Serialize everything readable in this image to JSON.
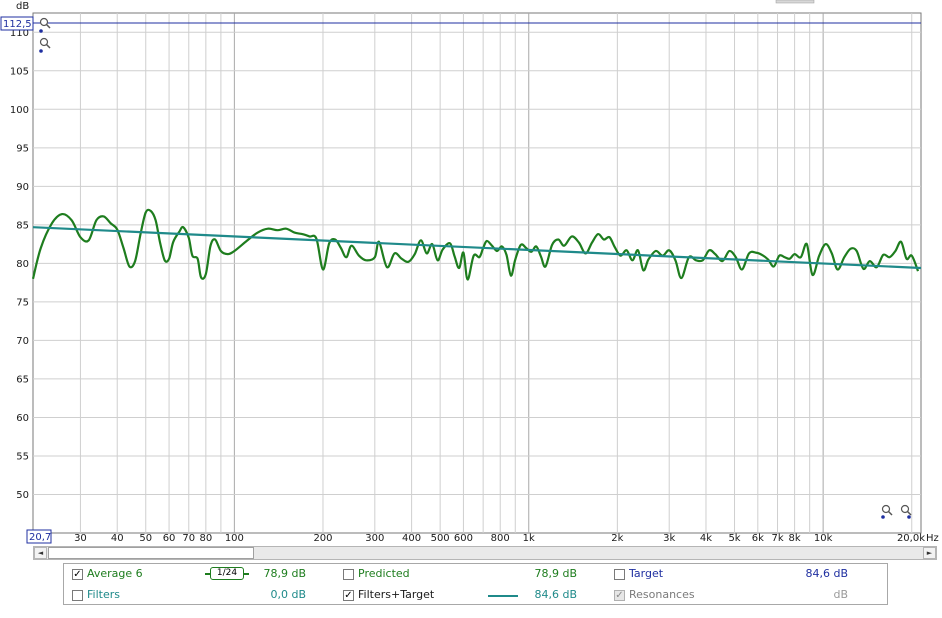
{
  "axis": {
    "y_unit": "dB",
    "x_unit": "Hz",
    "y_top_value": "112,5",
    "x_left_value": "20,7",
    "y_ticks": [
      "110",
      "105",
      "100",
      "95",
      "90",
      "85",
      "80",
      "75",
      "70",
      "65",
      "60",
      "55",
      "50"
    ],
    "x_tick_labels": [
      {
        "label": "30",
        "freq": 30
      },
      {
        "label": "40",
        "freq": 40
      },
      {
        "label": "50",
        "freq": 50
      },
      {
        "label": "60",
        "freq": 60
      },
      {
        "label": "70",
        "freq": 70
      },
      {
        "label": "80",
        "freq": 80
      },
      {
        "label": "100",
        "freq": 100
      },
      {
        "label": "200",
        "freq": 200
      },
      {
        "label": "300",
        "freq": 300
      },
      {
        "label": "400",
        "freq": 400
      },
      {
        "label": "500",
        "freq": 500
      },
      {
        "label": "600",
        "freq": 600
      },
      {
        "label": "800",
        "freq": 800
      },
      {
        "label": "1k",
        "freq": 1000
      },
      {
        "label": "2k",
        "freq": 2000
      },
      {
        "label": "3k",
        "freq": 3000
      },
      {
        "label": "4k",
        "freq": 4000
      },
      {
        "label": "5k",
        "freq": 5000
      },
      {
        "label": "6k",
        "freq": 6000
      },
      {
        "label": "7k",
        "freq": 7000
      },
      {
        "label": "8k",
        "freq": 8000
      },
      {
        "label": "10k",
        "freq": 10000
      },
      {
        "label": "20,0k",
        "freq": 20000
      }
    ]
  },
  "chart_data": {
    "type": "line",
    "x_scale": "log",
    "xlim": [
      20.7,
      21500
    ],
    "ylim": [
      45,
      112.5
    ],
    "grid": true,
    "series": [
      {
        "name": "Average 6",
        "color": "#1e7d1e",
        "points": [
          [
            20.7,
            78
          ],
          [
            22,
            82
          ],
          [
            24,
            85.2
          ],
          [
            26,
            86.4
          ],
          [
            28,
            85.6
          ],
          [
            30,
            83.4
          ],
          [
            32,
            83
          ],
          [
            34,
            85.6
          ],
          [
            36,
            86.1
          ],
          [
            38,
            85.2
          ],
          [
            40,
            84.4
          ],
          [
            42,
            82
          ],
          [
            44,
            79.6
          ],
          [
            46,
            80.3
          ],
          [
            48,
            83.8
          ],
          [
            50,
            86.6
          ],
          [
            52,
            86.8
          ],
          [
            54,
            85.6
          ],
          [
            56,
            82.6
          ],
          [
            58,
            80.4
          ],
          [
            60,
            80.6
          ],
          [
            62,
            82.8
          ],
          [
            65,
            84.1
          ],
          [
            67,
            84.7
          ],
          [
            70,
            83.3
          ],
          [
            72,
            81
          ],
          [
            75,
            80.6
          ],
          [
            77,
            78.2
          ],
          [
            80,
            78.6
          ],
          [
            83,
            82.3
          ],
          [
            86,
            83.1
          ],
          [
            90,
            81.6
          ],
          [
            95,
            81.2
          ],
          [
            100,
            81.6
          ],
          [
            110,
            82.9
          ],
          [
            120,
            84
          ],
          [
            130,
            84.5
          ],
          [
            140,
            84.3
          ],
          [
            150,
            84.5
          ],
          [
            160,
            84
          ],
          [
            170,
            83.8
          ],
          [
            180,
            83.5
          ],
          [
            190,
            83.2
          ],
          [
            200,
            79.2
          ],
          [
            210,
            82.6
          ],
          [
            220,
            83.1
          ],
          [
            230,
            82
          ],
          [
            240,
            80.8
          ],
          [
            250,
            82.3
          ],
          [
            265,
            81
          ],
          [
            280,
            80.4
          ],
          [
            300,
            80.8
          ],
          [
            310,
            82.8
          ],
          [
            330,
            79.5
          ],
          [
            350,
            81.3
          ],
          [
            370,
            80.6
          ],
          [
            390,
            80.2
          ],
          [
            410,
            81.2
          ],
          [
            430,
            83
          ],
          [
            450,
            81.3
          ],
          [
            470,
            82.5
          ],
          [
            490,
            80.4
          ],
          [
            510,
            81.8
          ],
          [
            540,
            82.6
          ],
          [
            560,
            80.9
          ],
          [
            580,
            79.4
          ],
          [
            600,
            81.4
          ],
          [
            620,
            77.9
          ],
          [
            650,
            81
          ],
          [
            680,
            80.8
          ],
          [
            700,
            82
          ],
          [
            720,
            82.9
          ],
          [
            750,
            82.3
          ],
          [
            780,
            81.6
          ],
          [
            810,
            82.2
          ],
          [
            840,
            81.1
          ],
          [
            870,
            78.4
          ],
          [
            900,
            80.5
          ],
          [
            940,
            82.4
          ],
          [
            980,
            82
          ],
          [
            1020,
            81.5
          ],
          [
            1060,
            82.2
          ],
          [
            1100,
            80.9
          ],
          [
            1140,
            79.6
          ],
          [
            1200,
            82.4
          ],
          [
            1260,
            83.1
          ],
          [
            1320,
            82.3
          ],
          [
            1400,
            83.5
          ],
          [
            1480,
            82.7
          ],
          [
            1560,
            81.3
          ],
          [
            1640,
            82.7
          ],
          [
            1720,
            83.8
          ],
          [
            1800,
            83.1
          ],
          [
            1880,
            83.4
          ],
          [
            1960,
            82.1
          ],
          [
            2050,
            81
          ],
          [
            2150,
            81.7
          ],
          [
            2250,
            80.4
          ],
          [
            2350,
            81.7
          ],
          [
            2450,
            79.1
          ],
          [
            2550,
            80.5
          ],
          [
            2700,
            81.6
          ],
          [
            2850,
            81
          ],
          [
            3000,
            81.7
          ],
          [
            3150,
            80.4
          ],
          [
            3300,
            78.1
          ],
          [
            3500,
            80.8
          ],
          [
            3700,
            80.4
          ],
          [
            3900,
            80.4
          ],
          [
            4100,
            81.7
          ],
          [
            4300,
            81.2
          ],
          [
            4550,
            80.3
          ],
          [
            4800,
            81.6
          ],
          [
            5050,
            80.8
          ],
          [
            5300,
            79.2
          ],
          [
            5600,
            81.3
          ],
          [
            5900,
            81.4
          ],
          [
            6200,
            81.1
          ],
          [
            6500,
            80.5
          ],
          [
            6800,
            79.6
          ],
          [
            7100,
            81
          ],
          [
            7400,
            80.8
          ],
          [
            7700,
            80.6
          ],
          [
            8000,
            81.2
          ],
          [
            8400,
            80.8
          ],
          [
            8800,
            82.5
          ],
          [
            9200,
            78.5
          ],
          [
            9700,
            81
          ],
          [
            10200,
            82.5
          ],
          [
            10700,
            81.3
          ],
          [
            11200,
            79.2
          ],
          [
            11800,
            80.8
          ],
          [
            12400,
            81.9
          ],
          [
            13000,
            81.6
          ],
          [
            13700,
            79.3
          ],
          [
            14400,
            80.3
          ],
          [
            15200,
            79.5
          ],
          [
            16000,
            81.1
          ],
          [
            16800,
            80.8
          ],
          [
            17600,
            81.6
          ],
          [
            18400,
            82.8
          ],
          [
            19200,
            80.6
          ],
          [
            20000,
            81
          ],
          [
            21000,
            79
          ]
        ]
      },
      {
        "name": "Target",
        "color": "#1f8a8a",
        "points": [
          [
            20.7,
            84.7
          ],
          [
            21500,
            79.4
          ]
        ]
      }
    ]
  },
  "legend": {
    "average": {
      "label": "Average 6",
      "checked": true,
      "smoothing": "1/24",
      "value": "78,9 dB",
      "color": "#1e7d1e"
    },
    "predicted": {
      "label": "Predicted",
      "checked": false,
      "value": "78,9 dB",
      "color": "#1e7d1e"
    },
    "target": {
      "label": "Target",
      "checked": false,
      "value": "84,6 dB",
      "color": "#1f2fa0"
    },
    "filters": {
      "label": "Filters",
      "checked": false,
      "value": "0,0 dB",
      "color": "#1f8a8a"
    },
    "filters_target": {
      "label": "Filters+Target",
      "checked": true,
      "value": "84,6 dB",
      "color": "#1f8a8a"
    },
    "resonances": {
      "label": "Resonances",
      "checked": true,
      "value": "dB",
      "color": "#7a7a7a"
    }
  },
  "scrollbar": {
    "left_arrow": "◄",
    "right_arrow": "►"
  },
  "checkmark": "✓"
}
